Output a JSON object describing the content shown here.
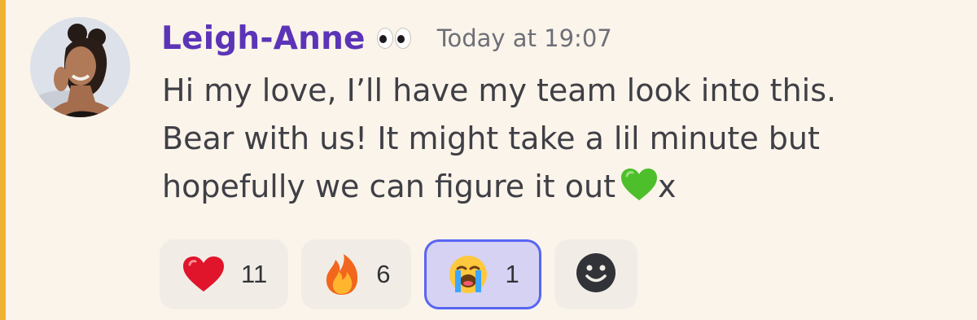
{
  "message": {
    "author": "Leigh-Anne",
    "author_badge_icon": "eyes-emoji",
    "timestamp": "Today at 19:07",
    "lines": [
      "Hi my love, I’ll have my team look into this.",
      "Bear with us! It might take a lil minute but",
      "hopefully we can figure it out"
    ],
    "trailing_emoji": "green-heart",
    "trailing_text": "x"
  },
  "reactions": [
    {
      "emoji": "red-heart",
      "count": "11",
      "selected": false
    },
    {
      "emoji": "fire",
      "count": "6",
      "selected": false
    },
    {
      "emoji": "loudly-crying-face",
      "count": "1",
      "selected": true
    }
  ],
  "add_reaction_icon": "smiley-add-reaction-icon",
  "colors": {
    "background": "#fbf4ea",
    "highlight_bar": "#f0b232",
    "username": "#5b34b8",
    "timestamp": "#6d6f78",
    "text": "#3f3f46",
    "selected_border": "#5865f2"
  }
}
